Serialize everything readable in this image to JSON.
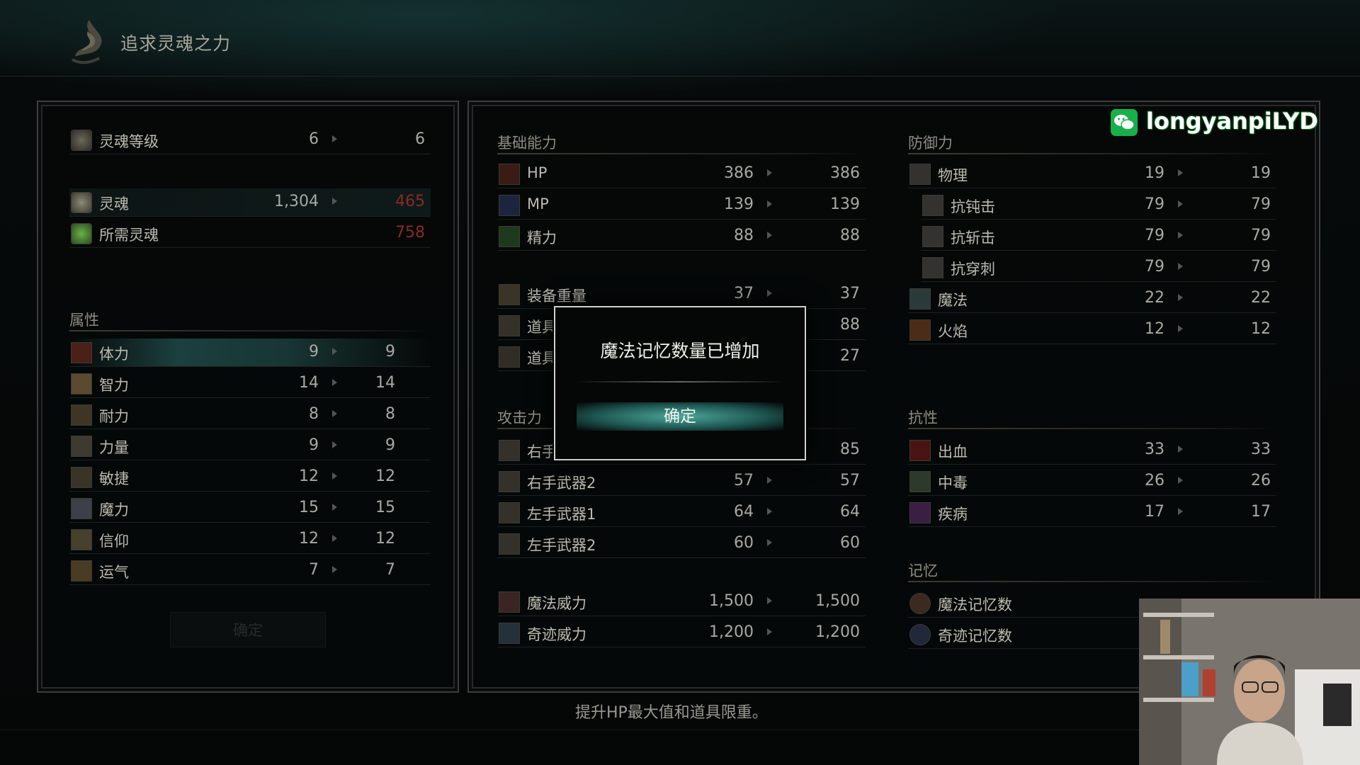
{
  "header": {
    "title": "追求灵魂之力"
  },
  "left": {
    "soul_level": {
      "label": "灵魂等级",
      "current": "6",
      "next": "6"
    },
    "souls": {
      "label": "灵魂",
      "current": "1,304",
      "next": "465"
    },
    "required": {
      "label": "所需灵魂",
      "next": "758"
    },
    "attr_title": "属性",
    "attributes": [
      {
        "label": "体力",
        "current": "9",
        "next": "9"
      },
      {
        "label": "智力",
        "current": "14",
        "next": "14"
      },
      {
        "label": "耐力",
        "current": "8",
        "next": "8"
      },
      {
        "label": "力量",
        "current": "9",
        "next": "9"
      },
      {
        "label": "敏捷",
        "current": "12",
        "next": "12"
      },
      {
        "label": "魔力",
        "current": "15",
        "next": "15"
      },
      {
        "label": "信仰",
        "current": "12",
        "next": "12"
      },
      {
        "label": "运气",
        "current": "7",
        "next": "7"
      }
    ],
    "confirm": "确定"
  },
  "basic": {
    "title": "基础能力",
    "rows": [
      {
        "label": "HP",
        "current": "386",
        "next": "386"
      },
      {
        "label": "MP",
        "current": "139",
        "next": "139"
      },
      {
        "label": "精力",
        "current": "88",
        "next": "88"
      }
    ],
    "rows2": [
      {
        "label": "装备重量",
        "current": "37",
        "next": "37"
      },
      {
        "label": "道具",
        "current": "",
        "next": "88"
      },
      {
        "label": "道具",
        "current": "",
        "next": "27"
      }
    ]
  },
  "attack": {
    "title": "攻击力",
    "rows": [
      {
        "label": "右手",
        "current": "",
        "next": "85"
      },
      {
        "label": "右手武器2",
        "current": "57",
        "next": "57"
      },
      {
        "label": "左手武器1",
        "current": "64",
        "next": "64"
      },
      {
        "label": "左手武器2",
        "current": "60",
        "next": "60"
      }
    ],
    "rows2": [
      {
        "label": "魔法威力",
        "current": "1,500",
        "next": "1,500"
      },
      {
        "label": "奇迹威力",
        "current": "1,200",
        "next": "1,200"
      }
    ]
  },
  "defense": {
    "title": "防御力",
    "rows": [
      {
        "label": "物理",
        "current": "19",
        "next": "19"
      },
      {
        "label": "抗钝击",
        "current": "79",
        "next": "79"
      },
      {
        "label": "抗斩击",
        "current": "79",
        "next": "79"
      },
      {
        "label": "抗穿刺",
        "current": "79",
        "next": "79"
      },
      {
        "label": "魔法",
        "current": "22",
        "next": "22"
      },
      {
        "label": "火焰",
        "current": "12",
        "next": "12"
      }
    ]
  },
  "resist": {
    "title": "抗性",
    "rows": [
      {
        "label": "出血",
        "current": "33",
        "next": "33"
      },
      {
        "label": "中毒",
        "current": "26",
        "next": "26"
      },
      {
        "label": "疾病",
        "current": "17",
        "next": "17"
      }
    ]
  },
  "memory": {
    "title": "记忆",
    "rows": [
      {
        "label": "魔法记忆数"
      },
      {
        "label": "奇迹记忆数"
      }
    ]
  },
  "dialog": {
    "message": "魔法记忆数量已增加",
    "ok": "确定"
  },
  "hint": "提升HP最大值和道具限重。",
  "watermark": "longyanpiLYD",
  "colors": {
    "accent": "#2f7f77",
    "negative": "#8a2a22",
    "watermark_green": "#18b04a"
  }
}
